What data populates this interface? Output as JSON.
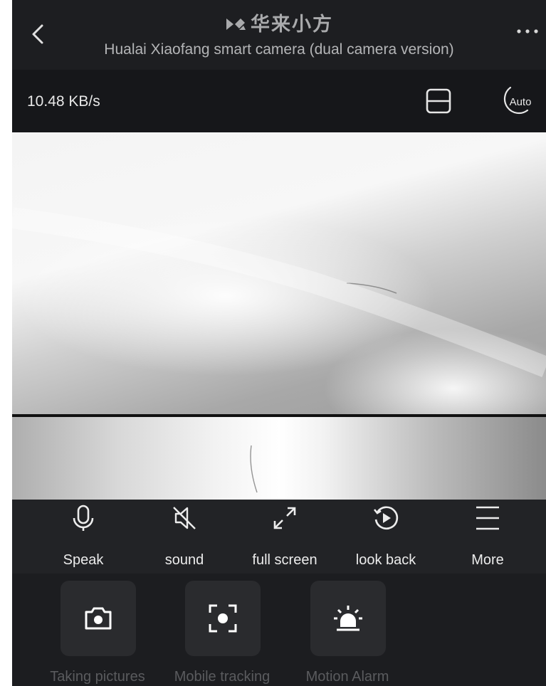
{
  "header": {
    "brand": "华来小方",
    "title": "Hualai Xiaofang smart camera (dual camera version)"
  },
  "toolbar": {
    "data_rate": "10.48 KB/s",
    "night_mode": "Auto"
  },
  "controls": [
    {
      "label": "Speak",
      "icon": "microphone-icon"
    },
    {
      "label": "sound",
      "icon": "speaker-muted-icon"
    },
    {
      "label": "full screen",
      "icon": "expand-icon"
    },
    {
      "label": "look back",
      "icon": "playback-icon"
    },
    {
      "label": "More",
      "icon": "menu-icon"
    }
  ],
  "features": [
    {
      "label": "Taking pictures",
      "icon": "camera-icon"
    },
    {
      "label": "Mobile tracking",
      "icon": "tracking-icon"
    },
    {
      "label": "Motion Alarm",
      "icon": "alarm-siren-icon"
    }
  ],
  "colors": {
    "background": "#191a1d",
    "control_bar": "#222326",
    "feature_tile": "#2a2b2e",
    "disabled_text": "#5a5b5e"
  }
}
